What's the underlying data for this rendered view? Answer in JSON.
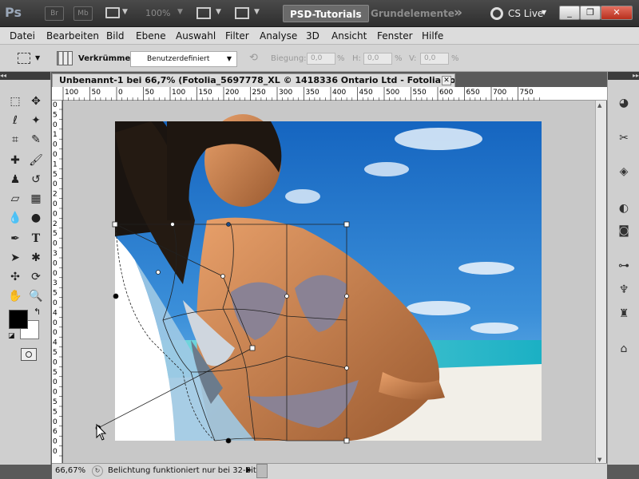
{
  "app": {
    "logo": "Ps",
    "bridge_label": "Br",
    "minibridge_label": "Mb",
    "zoom": "100%",
    "workspace_tab_active": "PSD-Tutorials",
    "workspace_tab_other": "Grundelemente",
    "more": "»",
    "cslive": "CS Live",
    "window_controls": [
      "_",
      "❐",
      "✕"
    ]
  },
  "menu": [
    "Datei",
    "Bearbeiten",
    "Bild",
    "Ebene",
    "Auswahl",
    "Filter",
    "Analyse",
    "3D",
    "Ansicht",
    "Fenster",
    "Hilfe"
  ],
  "options": {
    "warp_label": "Verkrümmen:",
    "warp_value": "Benutzerdefiniert",
    "bend_label": "Biegung:",
    "bend_value": "0,0",
    "h_label": "H:",
    "h_value": "0,0",
    "v_label": "V:",
    "v_value": "0,0",
    "percent": "%"
  },
  "document": {
    "title": "Unbenannt-1 bei 66,7% (Fotolia_5697778_XL © 1418336 Ontario Ltd - Fotolia.com, RGB/8) *",
    "close": "✕"
  },
  "ruler": {
    "top_labels": [
      "100",
      "50",
      "0",
      "50",
      "100",
      "150",
      "200",
      "250",
      "300",
      "350",
      "400",
      "450",
      "500",
      "550",
      "600",
      "650",
      "700",
      "750"
    ],
    "left_labels": [
      "0",
      "5",
      "0",
      "1",
      "0",
      "0",
      "1",
      "5",
      "0",
      "2",
      "0",
      "0",
      "2",
      "5",
      "0",
      "3",
      "0",
      "0",
      "3",
      "5",
      "0",
      "4",
      "0",
      "0",
      "4",
      "5",
      "0",
      "5",
      "0",
      "0",
      "5",
      "5",
      "0",
      "6",
      "0",
      "0"
    ]
  },
  "status": {
    "zoom": "66,67%",
    "message": "Belichtung funktioniert nur bei 32-Bit"
  },
  "colors": {
    "foreground": "#000000",
    "background": "#ffffff",
    "active_tab": "#5a5a5a",
    "sky_top": "#1565c0",
    "sky_bottom": "#4aa3e6",
    "sea": "#2fb8c9"
  },
  "icons": {
    "left_tools": [
      "marquee-icon",
      "move-icon",
      "lasso-icon",
      "magic-wand-icon",
      "crop-icon",
      "eyedropper-icon",
      "healing-brush-icon",
      "brush-icon",
      "stamp-icon",
      "history-brush-icon",
      "eraser-icon",
      "gradient-icon",
      "blur-icon",
      "dodge-icon",
      "pen-icon",
      "type-icon",
      "path-select-icon",
      "shape-icon",
      "3d-rotate-icon",
      "3d-orbit-icon",
      "hand-icon",
      "zoom-icon"
    ],
    "right_panels": [
      "color-panel-icon",
      "adjust-panel-icon",
      "layers-panel-icon",
      "masks-panel-icon",
      "channels-panel-icon",
      "paths-panel-icon",
      "brush-panel-icon",
      "clone-panel-icon",
      "transform-panel-icon"
    ]
  }
}
